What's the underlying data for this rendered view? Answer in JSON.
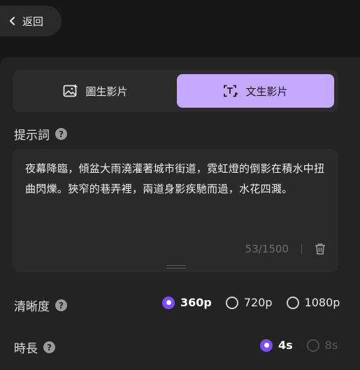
{
  "header": {
    "back_label": "返回"
  },
  "mode_tabs": [
    {
      "label": "圖生影片",
      "icon": "image-icon",
      "selected": false
    },
    {
      "label": "文生影片",
      "icon": "text-icon",
      "selected": true
    }
  ],
  "prompt": {
    "label": "提示詞",
    "text": "夜幕降臨，傾盆大雨澆灌著城市街道，霓虹燈的倒影在積水中扭曲閃爍。狹窄的巷弄裡，兩道身影疾馳而過，水花四濺。",
    "counter": "53/1500"
  },
  "resolution": {
    "label": "清晰度",
    "options": [
      {
        "label": "360p",
        "selected": true
      },
      {
        "label": "720p",
        "selected": false
      },
      {
        "label": "1080p",
        "selected": false
      }
    ]
  },
  "duration": {
    "label": "時長",
    "options": [
      {
        "label": "4s",
        "selected": true,
        "disabled": false
      },
      {
        "label": "8s",
        "selected": false,
        "disabled": true
      }
    ]
  },
  "colors": {
    "accent": "#7c4dff",
    "tab_selected_bg": "#c4a9ff"
  }
}
